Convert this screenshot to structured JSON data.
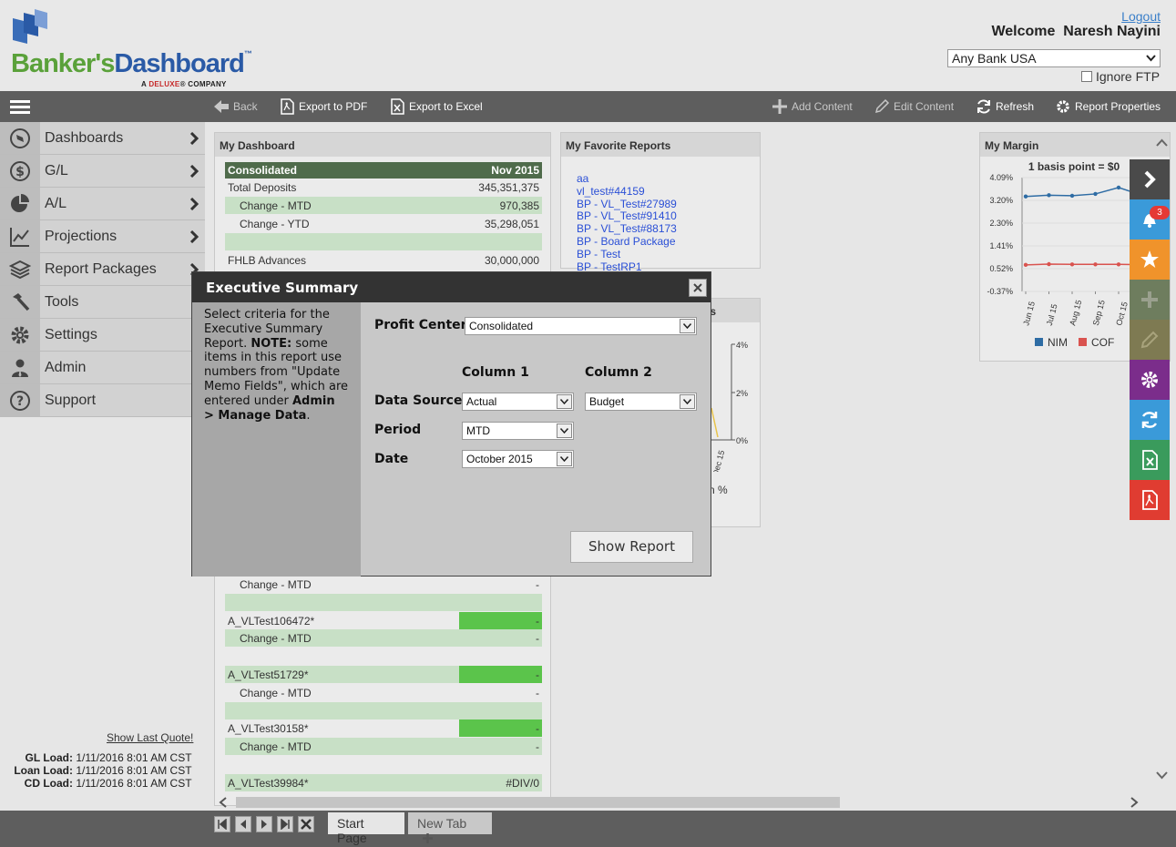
{
  "header": {
    "logo_text_1": "Banker's",
    "logo_text_2": "Dashboard",
    "logo_tm": "™",
    "logo_sub_1": "A ",
    "logo_sub_brand": "DELUXE",
    "logo_sub_2": "® COMPANY",
    "logout": "Logout",
    "welcome": "Welcome  Naresh Nayini",
    "bank_select": "Any Bank USA",
    "ignore_ftp": "Ignore FTP"
  },
  "toolbar": {
    "back": "Back",
    "export_pdf": "Export to PDF",
    "export_excel": "Export to Excel",
    "add_content": "Add Content",
    "edit_content": "Edit Content",
    "refresh": "Refresh",
    "report_properties": "Report Properties"
  },
  "sidebar": {
    "items": [
      {
        "label": "Dashboards",
        "icon": "compass-icon"
      },
      {
        "label": "G/L",
        "icon": "dollar-icon"
      },
      {
        "label": "A/L",
        "icon": "pie-chart-icon"
      },
      {
        "label": "Projections",
        "icon": "line-chart-icon"
      },
      {
        "label": "Report Packages",
        "icon": "layers-icon"
      },
      {
        "label": "Tools",
        "icon": "hammer-icon"
      },
      {
        "label": "Settings",
        "icon": "gear-icon"
      },
      {
        "label": "Admin",
        "icon": "user-icon"
      },
      {
        "label": "Support",
        "icon": "help-icon"
      }
    ],
    "show_last_quote": "Show Last Quote!",
    "loads": [
      {
        "label": "GL Load:",
        "value": "1/11/2016 8:01 AM CST"
      },
      {
        "label": "Loan Load:",
        "value": "1/11/2016 8:01 AM CST"
      },
      {
        "label": "CD Load:",
        "value": "1/11/2016 8:01 AM CST"
      }
    ]
  },
  "dashboard": {
    "title": "My Dashboard",
    "head_left": "Consolidated",
    "head_right": "Nov 2015",
    "rows_top": [
      {
        "label": "Total Deposits",
        "value": "345,351,375"
      },
      {
        "label": "Change - MTD",
        "value": "970,385"
      },
      {
        "label": "Change - YTD",
        "value": "35,298,051"
      },
      {
        "label": "",
        "value": ""
      },
      {
        "label": "FHLB Advances",
        "value": "30,000,000"
      }
    ],
    "rows_bottom": [
      {
        "label": "Change - MTD",
        "value": "-"
      },
      {
        "label": "",
        "value": ""
      },
      {
        "label": "A_VLTest106472*",
        "value": "-"
      },
      {
        "label": "Change - MTD",
        "value": "-"
      },
      {
        "label": "A_VLTest51729*",
        "value": "-"
      },
      {
        "label": "Change - MTD",
        "value": "-"
      },
      {
        "label": "A_VLTest30158*",
        "value": "-"
      },
      {
        "label": "Change - MTD",
        "value": "-"
      },
      {
        "label": "A_VLTest39984*",
        "value": "#DIV/0"
      }
    ]
  },
  "favorites": {
    "title": "My Favorite Reports",
    "links": [
      "aa",
      "vl_test#44159",
      "BP - VL_Test#27989",
      "BP - VL_Test#91410",
      "BP - VL_Test#88173",
      "BP - Board Package",
      "BP - Test",
      "BP - TestRP1"
    ]
  },
  "hidden_panel": {
    "title_tail": "s",
    "y_ticks": [
      "4%",
      "2%",
      "0%"
    ],
    "x_tick": "Dec 15",
    "legend_tail": "n %"
  },
  "margin": {
    "title": "My Margin"
  },
  "chart_data": {
    "type": "line",
    "title": "1 basis point = $0",
    "categories": [
      "Jun 15",
      "Jul 15",
      "Aug 15",
      "Sep 15",
      "Oct 15",
      "Nov 15"
    ],
    "y_ticks": [
      "4.09%",
      "3.20%",
      "2.30%",
      "1.41%",
      "0.52%",
      "-0.37%"
    ],
    "ylim": [
      -0.37,
      4.09
    ],
    "series": [
      {
        "name": "NIM",
        "color": "#2e6ca4",
        "values": [
          3.35,
          3.4,
          3.38,
          3.45,
          3.7,
          3.4
        ]
      },
      {
        "name": "COF",
        "color": "#d9534f",
        "values": [
          0.67,
          0.7,
          0.69,
          0.69,
          0.69,
          0.68
        ]
      }
    ],
    "grid": true,
    "legend": "bottom"
  },
  "rail": {
    "notification_count": "3",
    "colors": [
      "#4a4a4a",
      "#3a9ad9",
      "#f0932b",
      "#6e7d5e",
      "#7e7a52",
      "#7b2d8b",
      "#3a9ad9",
      "#3a9b5c",
      "#e03c31"
    ]
  },
  "tabs": {
    "start_page": "Start Page",
    "new_tab": "New Tab"
  },
  "dialog": {
    "title": "Executive Summary",
    "note_1": "Select criteria for the Executive Summary Report. ",
    "note_bold_1": "NOTE:",
    "note_2": " some items in this report use numbers from \"Update Memo Fields\", which are entered under ",
    "note_bold_2": "Admin > Manage Data",
    "note_3": ".",
    "profit_center_label": "Profit Center",
    "profit_center_value": "Consolidated",
    "column1_header": "Column 1",
    "column2_header": "Column 2",
    "data_source_label": "Data Source",
    "data_source_col1": "Actual",
    "data_source_col2": "Budget",
    "period_label": "Period",
    "period_value": "MTD",
    "date_label": "Date",
    "date_value": "October 2015",
    "show_report": "Show Report"
  }
}
